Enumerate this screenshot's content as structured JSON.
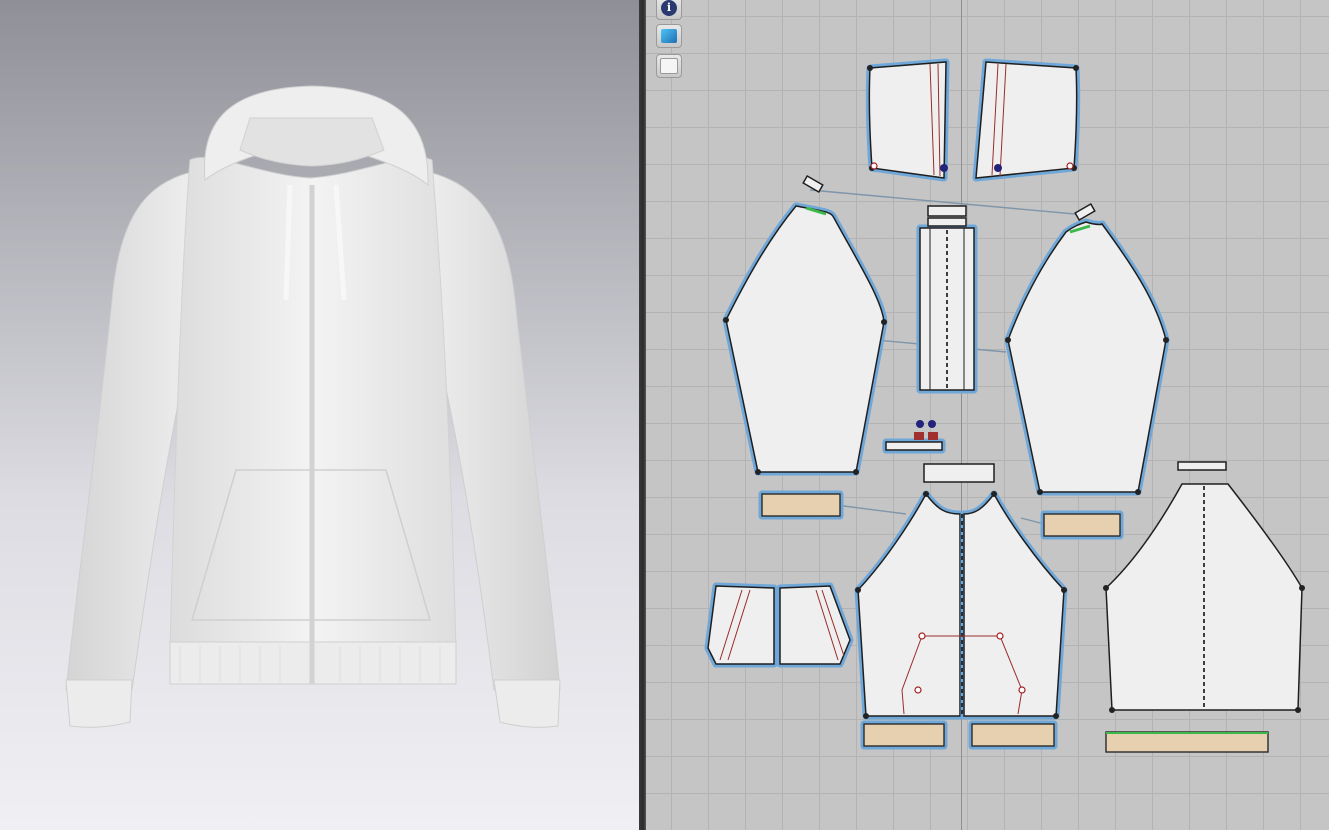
{
  "views": {
    "left": "3d-garment-view",
    "right": "2d-pattern-view"
  },
  "toolbar": {
    "buttons": [
      {
        "icon": "info-icon"
      },
      {
        "icon": "texture-book-icon"
      },
      {
        "icon": "locked-garment-icon"
      }
    ]
  },
  "garment": {
    "type": "zip hoodie",
    "color": "#f2f2f2"
  },
  "colors": {
    "selection_halo": "#6ea7d8",
    "rib_fill": "#e7d0b0",
    "piece_fill": "#efefef",
    "internal_line": "#9b2b2b",
    "seam_green": "#3cb84a"
  }
}
